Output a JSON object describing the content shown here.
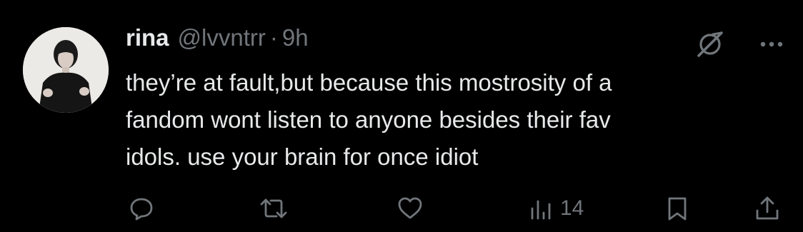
{
  "tweet": {
    "author": {
      "display_name": "rina",
      "handle": "@lvvntrr"
    },
    "separator": "·",
    "timestamp": "9h",
    "text_lines": [
      "they’re at fault,but because this mostrosity of a",
      "fandom wont listen to anyone besides their fav",
      "idols. use your brain for once idiot"
    ],
    "stats": {
      "views": "14"
    },
    "icons": {
      "grok": "grok-icon",
      "more": "more-dots-icon",
      "reply": "reply-icon",
      "retweet": "retweet-icon",
      "like": "heart-icon",
      "views": "views-bar-icon",
      "bookmark": "bookmark-icon",
      "share": "share-icon"
    }
  },
  "colors": {
    "background": "#000000",
    "primary_text": "#e7e9ea",
    "secondary_text": "#71767b"
  }
}
